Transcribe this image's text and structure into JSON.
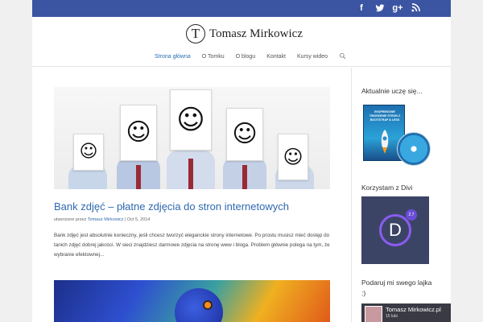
{
  "colors": {
    "topbar": "#3b55a3",
    "accent": "#2f6ab0",
    "divi_bg": "#3c4466"
  },
  "topbar": {
    "social_icons": [
      {
        "name": "facebook-icon",
        "glyph": "f"
      },
      {
        "name": "twitter-icon",
        "glyph": "t"
      },
      {
        "name": "google-plus-icon",
        "glyph": "g+"
      },
      {
        "name": "rss-icon",
        "glyph": "◗"
      }
    ]
  },
  "header": {
    "logo_letter": "T",
    "site_name": "Tomasz Mirkowicz"
  },
  "nav": {
    "items": [
      {
        "label": "Strona główna",
        "active": true
      },
      {
        "label": "O Tomku",
        "active": false
      },
      {
        "label": "O blogu",
        "active": false
      },
      {
        "label": "Kontakt",
        "active": false
      },
      {
        "label": "Kursy wideo",
        "active": false
      }
    ],
    "search_glyph": "⌕"
  },
  "post": {
    "title": "Bank zdjęć – płatne zdjęcia do stron internetowych",
    "meta_prefix": "utworzone przez",
    "author": "Tomasz Mirkowicz",
    "separator": "|",
    "date": "Oct 5, 2014",
    "excerpt": "Bank zdjęć jest absolutnie konieczny, jeśli chcesz tworzyć eleganckie strony internetowe. Po prostu musisz mieć dostęp do tanich zdjęć dobrej jakości. W sieci znajdziesz darmowe zdjęcia na stronę www i bloga. Problem głównie polega na tym, że wybranie efektownej..."
  },
  "sidebar": {
    "widget1_title": "Aktualnie uczę się...",
    "course_box_text": "EKSPRESOWE TWORZENIE STRON Z BOOTSTRAP & LESS",
    "widget2_title": "Korzystam z Divi",
    "divi_letter": "D",
    "divi_version": "2.7",
    "widget3_title": "Podaruj mi swego lajka :)",
    "fb_name": "Tomasz Mirkowicz.pl",
    "fb_likes": "15 lubi"
  }
}
